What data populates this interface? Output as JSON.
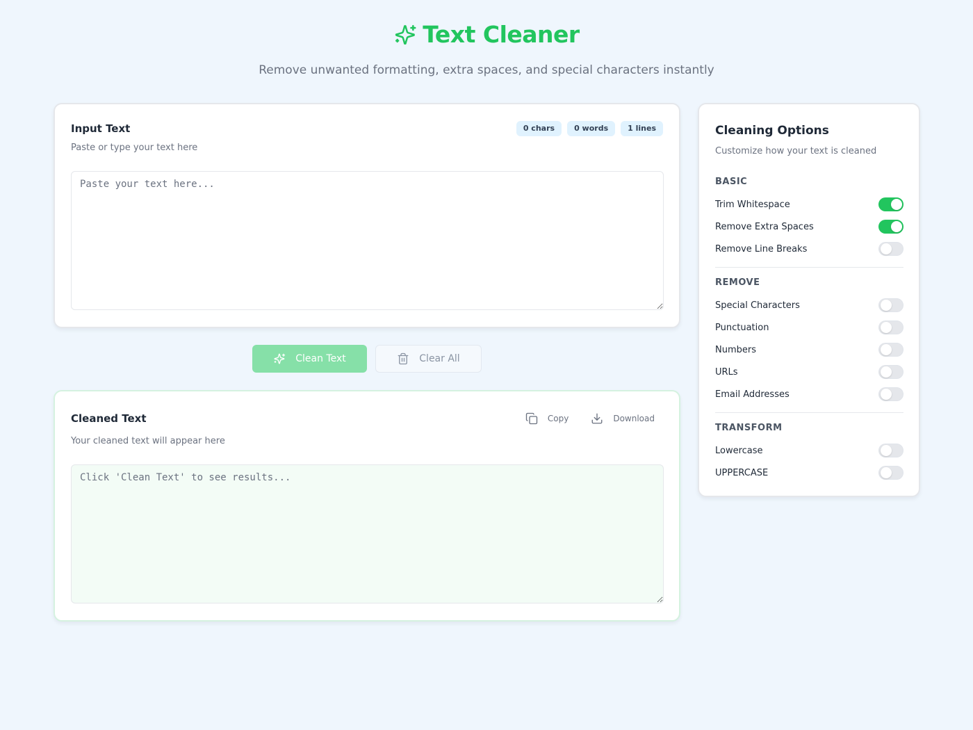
{
  "header": {
    "title": "Text Cleaner",
    "subtitle": "Remove unwanted formatting, extra spaces, and special characters instantly",
    "icon": "sparkle-icon"
  },
  "input_card": {
    "title": "Input Text",
    "description": "Paste or type your text here",
    "placeholder": "Paste your text here...",
    "value": "",
    "stats": {
      "chars": "0 chars",
      "words": "0 words",
      "lines": "1 lines"
    }
  },
  "actions": {
    "clean_label": "Clean Text",
    "clear_label": "Clear All"
  },
  "output_card": {
    "title": "Cleaned Text",
    "description": "Your cleaned text will appear here",
    "placeholder": "Click 'Clean Text' to see results...",
    "copy_label": "Copy",
    "download_label": "Download"
  },
  "options": {
    "title": "Cleaning Options",
    "description": "Customize how your text is cleaned",
    "sections": {
      "basic": {
        "label": "BASIC",
        "items": [
          {
            "label": "Trim Whitespace",
            "on": true
          },
          {
            "label": "Remove Extra Spaces",
            "on": true
          },
          {
            "label": "Remove Line Breaks",
            "on": false
          }
        ]
      },
      "remove": {
        "label": "REMOVE",
        "items": [
          {
            "label": "Special Characters",
            "on": false
          },
          {
            "label": "Punctuation",
            "on": false
          },
          {
            "label": "Numbers",
            "on": false
          },
          {
            "label": "URLs",
            "on": false
          },
          {
            "label": "Email Addresses",
            "on": false
          }
        ]
      },
      "transform": {
        "label": "TRANSFORM",
        "items": [
          {
            "label": "Lowercase",
            "on": false
          },
          {
            "label": "UPPERCASE",
            "on": false
          }
        ]
      }
    }
  },
  "colors": {
    "accent": "#22c55e",
    "accent_light": "#86e0a8",
    "background": "#eff6fd"
  }
}
